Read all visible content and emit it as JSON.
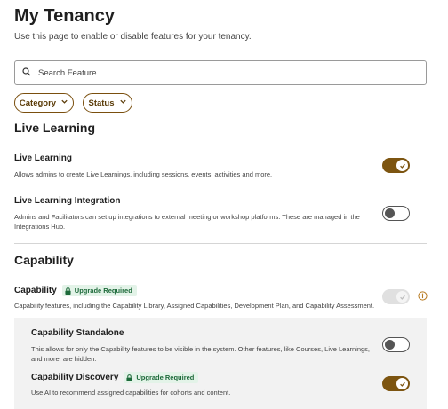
{
  "header": {
    "title": "My Tenancy",
    "subtitle": "Use this page to enable or disable features for your tenancy."
  },
  "search": {
    "placeholder": "Search Feature",
    "value": ""
  },
  "filters": {
    "category_label": "Category",
    "status_label": "Status"
  },
  "sections": {
    "live_learning": {
      "heading": "Live Learning",
      "features": [
        {
          "title": "Live Learning",
          "description": "Allows admins to create Live Learnings, including sessions, events, activities and more.",
          "enabled": true
        },
        {
          "title": "Live Learning Integration",
          "description": "Admins and Facilitators can set up integrations to external meeting or workshop platforms. These are managed in the Integrations Hub.",
          "enabled": false
        }
      ]
    },
    "capability": {
      "heading": "Capability",
      "features": [
        {
          "title": "Capability",
          "badge": "Upgrade Required",
          "description": "Capability features, including the Capability Library, Assigned Capabilities, Development Plan, and Capability Assessment.",
          "enabled": true,
          "disabled": true
        },
        {
          "title": "Capability Standalone",
          "description": "This allows for only the Capability features to be visible in the system. Other features, like Courses, Live Learnings, and more, are hidden.",
          "enabled": false
        },
        {
          "title": "Capability Discovery",
          "badge": "Upgrade Required",
          "description": "Use AI to recommend assigned capabilities for cohorts and content.",
          "enabled": true
        }
      ]
    }
  },
  "icons": {
    "search": "search-icon",
    "chevron": "chevron-down-icon",
    "lock": "lock-icon",
    "check": "check-icon",
    "info": "info-icon"
  },
  "colors": {
    "accent": "#7d5511",
    "badge_bg": "#e3f3e8",
    "badge_text": "#1d6a3a",
    "info": "#b7791f"
  }
}
